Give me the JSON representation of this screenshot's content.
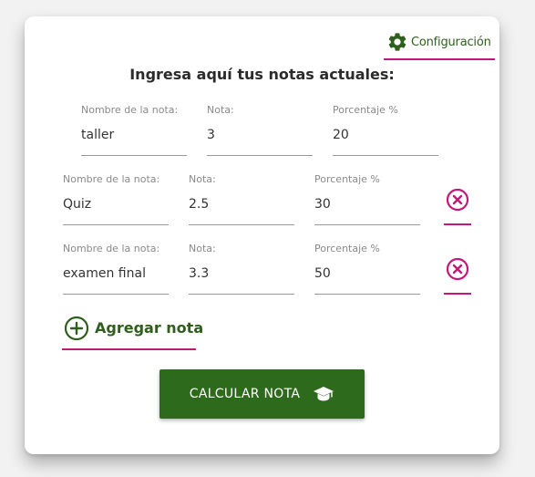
{
  "colors": {
    "accent": "#c2187a",
    "primary_green": "#2e6a1c",
    "card_background": "#ffffff"
  },
  "config": {
    "label": "Configuración",
    "icon": "gear-icon"
  },
  "title": "Ingresa aquí tus notas actuales:",
  "labels": {
    "name": "Nombre de la nota:",
    "grade": "Nota:",
    "percentage": "Porcentaje %"
  },
  "grades": [
    {
      "name": "taller",
      "grade": "3",
      "percentage": "20",
      "removable": false
    },
    {
      "name": "Quiz",
      "grade": "2.5",
      "percentage": "30",
      "removable": true
    },
    {
      "name": "examen final",
      "grade": "3.3",
      "percentage": "50",
      "removable": true
    }
  ],
  "add_button": {
    "label": "Agregar nota",
    "icon": "plus-circle-icon"
  },
  "calculate_button": {
    "label": "CALCULAR NOTA",
    "icon": "graduation-cap-icon"
  }
}
